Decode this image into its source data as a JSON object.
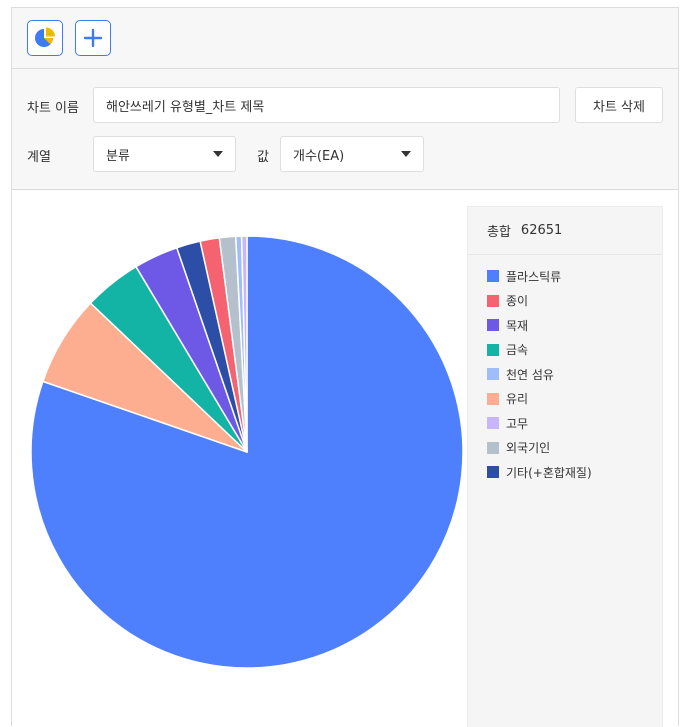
{
  "toolbar": {
    "pie_icon": "pie-chart-icon",
    "add_icon": "plus-icon"
  },
  "settings": {
    "chart_name_label": "차트 이름",
    "chart_name_value": "해안쓰레기 유형별_차트 제목",
    "delete_label": "차트 삭제",
    "series_label": "계열",
    "series_value": "분류",
    "value_label": "값",
    "value_value": "개수(EA)"
  },
  "legend": {
    "total_label": "총합",
    "total_value": "62651"
  },
  "chart_data": {
    "type": "pie",
    "total": 62651,
    "categories": [
      "플라스틱류",
      "종이",
      "목재",
      "금속",
      "천연 섬유",
      "유리",
      "고무",
      "외국기인",
      "기타(+혼합재질)"
    ],
    "colors": [
      "#4e7ffd",
      "#f4636f",
      "#6e59e6",
      "#13b3a5",
      "#9fbdfa",
      "#fdae90",
      "#c9b5fb",
      "#b4c1cc",
      "#2d4ea6"
    ],
    "slices": [
      {
        "label": "플라스틱류",
        "value": 50310,
        "color": "#4e7ffd"
      },
      {
        "label": "유리",
        "value": 4260,
        "color": "#fdae90"
      },
      {
        "label": "금속",
        "value": 2700,
        "color": "#13b3a5"
      },
      {
        "label": "목재",
        "value": 2080,
        "color": "#6e59e6"
      },
      {
        "label": "기타(+혼합재질)",
        "value": 1120,
        "color": "#2d4ea6"
      },
      {
        "label": "종이",
        "value": 900,
        "color": "#f4636f"
      },
      {
        "label": "외국기인",
        "value": 760,
        "color": "#b4c1cc"
      },
      {
        "label": "천연 섬유",
        "value": 271,
        "color": "#9fbdfa"
      },
      {
        "label": "고무",
        "value": 250,
        "color": "#c9b5fb"
      }
    ]
  }
}
